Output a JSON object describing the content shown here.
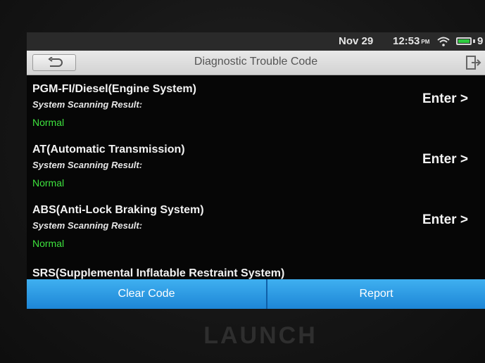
{
  "status": {
    "date": "Nov 29",
    "time": "12:53",
    "ampm": "PM",
    "overflow": "9"
  },
  "header": {
    "title": "Diagnostic Trouble Code"
  },
  "systems": [
    {
      "name": "PGM-FI/Diesel(Engine System)",
      "subtitle": "System Scanning Result:",
      "result": "Normal",
      "enter_label": "Enter >"
    },
    {
      "name": "AT(Automatic Transmission)",
      "subtitle": "System Scanning Result:",
      "result": "Normal",
      "enter_label": "Enter >"
    },
    {
      "name": "ABS(Anti-Lock Braking System)",
      "subtitle": "System Scanning Result:",
      "result": "Normal",
      "enter_label": "Enter >"
    },
    {
      "name": "SRS(Supplemental Inflatable Restraint System)"
    }
  ],
  "footer": {
    "clear_label": "Clear Code",
    "report_label": "Report"
  },
  "device": {
    "brand": "LAUNCH"
  },
  "colors": {
    "accent": "#2b9be6",
    "ok": "#3ee23e",
    "background": "#060606"
  }
}
